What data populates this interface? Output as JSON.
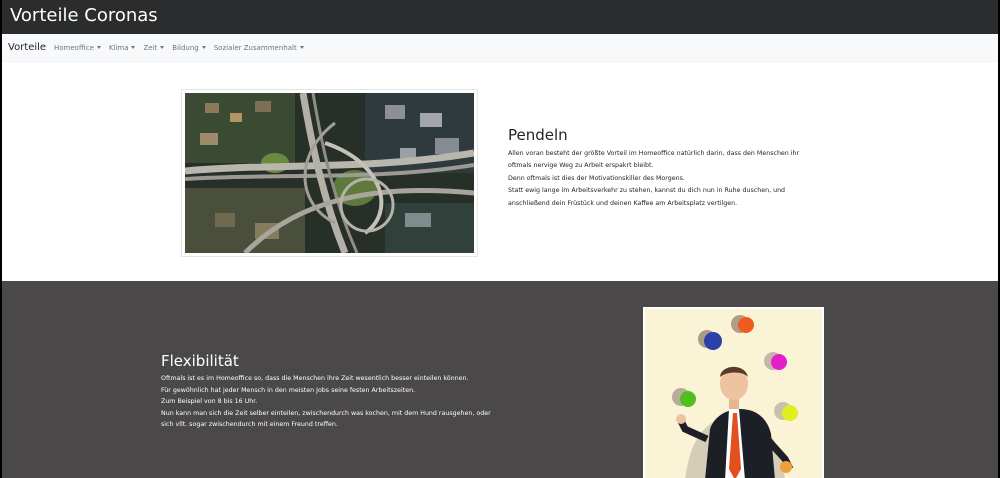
{
  "header": {
    "title": "Vorteile Coronas"
  },
  "navbar": {
    "brand": "Vorteile",
    "items": [
      {
        "label": "Homeoffice"
      },
      {
        "label": "Klima"
      },
      {
        "label": "Zeit"
      },
      {
        "label": "Bildung"
      },
      {
        "label": "Sozialer Zusammenhalt"
      }
    ]
  },
  "section1": {
    "image": "city-highway-interchange-photo",
    "heading": "Pendeln",
    "lines": [
      "Allen voran besteht der größte Vorteil im Homeoffice natürlich darin, dass den Menschen ihr",
      "oftmals nervige Weg zu Arbeit erspakrt bleibt.",
      "Denn oftmals ist dies der Motivationskiller des Morgens.",
      "Statt ewig lange im Arbeitsverkehr zu stehen, kannst du dich nun in Ruhe duschen, und",
      "anschließend dein Früstück und deinen Kaffee am Arbeitsplatz vertilgen."
    ]
  },
  "section2": {
    "image": "juggling-businessman-illustration",
    "heading": "Flexibilität",
    "lines": [
      "Oftmals ist es im Homeoffice so, dass die Menschen ihre Zeit wesentlich besser einteilen können.",
      "Für gewöhnlich hat jeder Mensch in den meisten Jobs seine festen Arbeitszeiten.",
      "Zum Beispiel von 8 bis 16 Uhr.",
      "Nun kann man sich die Zeit selber einteilen, zwischendurch was kochen, mit dem Hund rausgehen, oder",
      "sich vllt. sogar zwischendurch mit einem Freund treffen."
    ]
  },
  "colors": {
    "header_bg": "#2b2c2e",
    "navbar_bg": "#f8f9fa",
    "dark_section_bg": "#4a4849"
  }
}
